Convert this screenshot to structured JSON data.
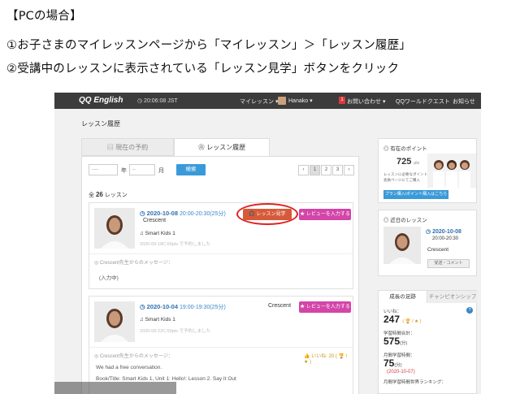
{
  "instructions": [
    "【PCの場合】",
    "①お子さまのマイレッスンページから「マイレッスン」＞「レッスン履歴」",
    "②受講中のレッスンに表示されている「レッスン見学」ボタンをクリック"
  ],
  "topbar": {
    "logo": "QQ English",
    "clock": "◷ 20:06:08 JST",
    "my_lesson": "マイレッスン  ▾",
    "user": "Hanako  ▾",
    "inquiry_badge": "1",
    "inquiry": "お問い合わせ  ▾",
    "quest": "QQワールドクエスト",
    "news": "お知らせ"
  },
  "page_title": "レッスン履歴",
  "tabs": {
    "reservation": "▤ 現在の予約",
    "history": "❀ レッスン履歴"
  },
  "filters": {
    "year_label": "年",
    "month_label": "月",
    "search": "検索",
    "year_value": "----",
    "month_value": "--",
    "pages": [
      "‹",
      "1",
      "2",
      "3",
      "›"
    ]
  },
  "count": {
    "prefix": "全",
    "number": "26",
    "suffix": "レッスン"
  },
  "lessons": [
    {
      "date": "2020-10-08",
      "time": "20:00-20:30(25分)",
      "teacher": "Crescent",
      "course": "♫ Smart Kids 1",
      "reserved": "2020-09-18C:60pts で予約しました",
      "watch": "🎧 レッスン見学",
      "review": "★ レビューを入力する",
      "msg_label": "◎ Crescent先生からのメッセージ：",
      "msg": "(入力中)"
    },
    {
      "date": "2020-10-04",
      "time": "19:00-19:30(25分)",
      "teacher": "Crescent",
      "course": "♫ Smart Kids 1",
      "reserved": "2020-09-22C:50pts で予約しました",
      "review": "★ レビューを入力する",
      "likes": "👍 いいね: 20 ( 🏆 / ★ )",
      "msg_label": "◎ Crescent先生からのメッセージ：",
      "msg1": "We had a free conversation.",
      "msg2": "Book/Title: Smart Kids 1, Unit 1: Hello!: Lesson 2. Say It Out"
    }
  ],
  "side": {
    "points_title": "◎ 有在のポイント",
    "points": "725",
    "points_unit": "pts",
    "points_note": "レッスンに必要なポイントを 会員ページにてご購入",
    "points_btn": "プラン購入/ポイント購入はこちら",
    "recent_title": "◎ 近日のレッスン",
    "recent_date": "2020-10-08",
    "recent_time": "20:00-20:30",
    "recent_teacher": "Crescent",
    "recent_btn": "受送・コメント",
    "tab_growth": "成長の足跡",
    "tab_champion": "チャンピオンシップ",
    "likes_label": "いいね：",
    "likes_value": "247",
    "likes_paren": "( 🏆 / ★ )",
    "total_label": "学習時間合計：",
    "total_value": "575",
    "total_unit": "(分)",
    "monthly_label": "月間学習時間：",
    "monthly_value": "75",
    "monthly_unit": "(分)",
    "monthly_date": "(2020-10-07)",
    "ranking": "月間学習時間世界ランキング："
  }
}
